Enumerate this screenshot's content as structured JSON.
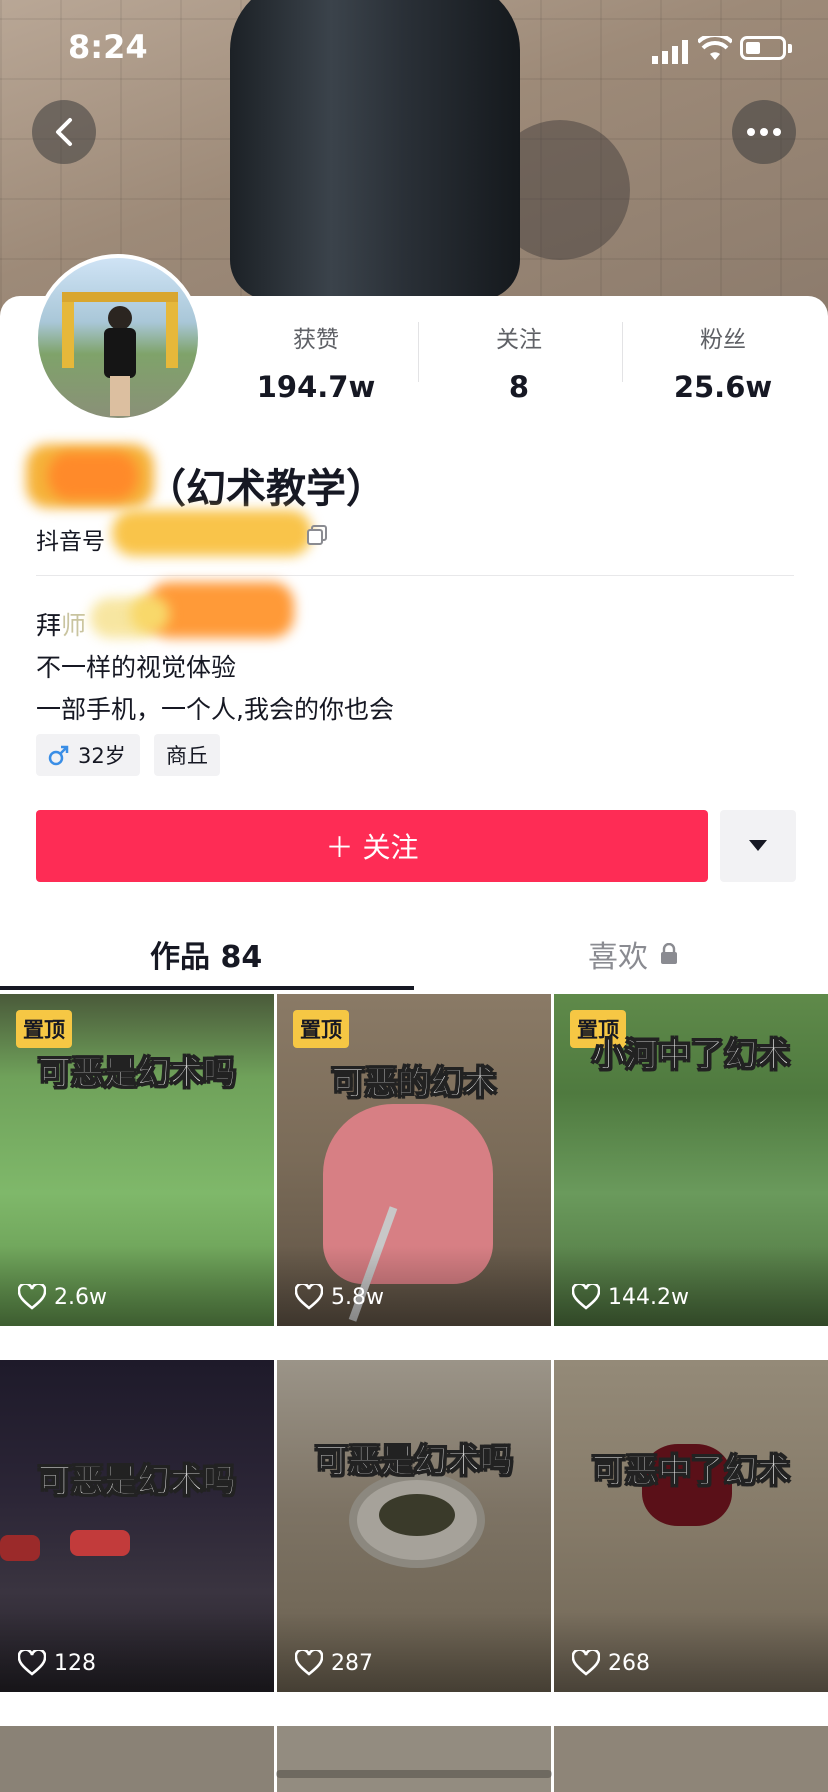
{
  "status_bar": {
    "time": "8:24"
  },
  "profile": {
    "name_suffix": "（幻术教学）",
    "id_label": "抖音号",
    "stats": [
      {
        "label": "获赞",
        "value": "194.7w"
      },
      {
        "label": "关注",
        "value": "8"
      },
      {
        "label": "粉丝",
        "value": "25.6w"
      }
    ],
    "bio_line1_prefix": "拜",
    "bio_line1_partial": "师",
    "bio_line2": "不一样的视觉体验",
    "bio_line3": "一部手机，一个人,我会的你也会",
    "age": "32岁",
    "location": "商丘"
  },
  "actions": {
    "follow_label": "＋ 关注"
  },
  "tabs": {
    "works": "作品 84",
    "likes": "喜欢"
  },
  "videos": [
    {
      "pinned": "置顶",
      "caption": "可恶是幻术吗",
      "likes": "2.6w"
    },
    {
      "pinned": "置顶",
      "caption": "可恶的幻术",
      "likes": "5.8w"
    },
    {
      "pinned": "置顶",
      "caption": "小河中了幻术",
      "likes": "144.2w"
    },
    {
      "pinned": "",
      "caption": "可恶是幻术吗",
      "likes": "128"
    },
    {
      "pinned": "",
      "caption": "可恶是幻术吗",
      "likes": "287"
    },
    {
      "pinned": "",
      "caption": "可恶中了幻术",
      "likes": "268"
    }
  ],
  "colors": {
    "accent": "#fe2c55",
    "pin": "#f6c744"
  }
}
